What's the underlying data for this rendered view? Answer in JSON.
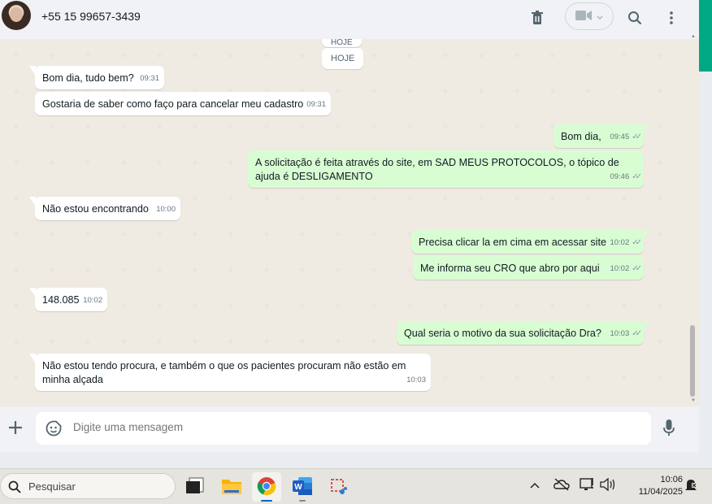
{
  "header": {
    "contact_name": "+55 15 99657-3439",
    "icons": [
      "delete-icon",
      "video-call-icon",
      "chevron-down-icon",
      "search-icon",
      "menu-icon"
    ]
  },
  "chat": {
    "date_chips": [
      "HOJE",
      "HOJE"
    ],
    "messages": [
      {
        "dir": "in",
        "text": "Bom dia, tudo bem?",
        "time": "09:31"
      },
      {
        "dir": "in",
        "text": "Gostaria de saber como faço para cancelar meu cadastro",
        "time": "09:31"
      },
      {
        "dir": "out",
        "text": "Bom dia,",
        "time": "09:45"
      },
      {
        "dir": "out",
        "text": "A solicitação é feita através do site, em SAD MEUS PROTOCOLOS, o tópico de ajuda é DESLIGAMENTO",
        "time": "09:46"
      },
      {
        "dir": "in",
        "text": "Não estou encontrando",
        "time": "10:00"
      },
      {
        "dir": "out",
        "text": "Precisa clicar la em cima em acessar site",
        "time": "10:02"
      },
      {
        "dir": "out",
        "text": "Me informa seu CRO que abro por aqui",
        "time": "10:02"
      },
      {
        "dir": "in",
        "text": "148.085",
        "time": "10:02"
      },
      {
        "dir": "out",
        "text": "Qual seria o motivo da sua solicitação Dra?",
        "time": "10:03"
      },
      {
        "dir": "in",
        "text": "Não estou tendo procura, e também o que os pacientes procuram não estão em minha alçada",
        "time": "10:03"
      }
    ]
  },
  "composer": {
    "placeholder": "Digite uma mensagem"
  },
  "taskbar": {
    "search_placeholder": "Pesquisar",
    "time": "10:06",
    "date": "11/04/2025"
  },
  "colors": {
    "incoming_bubble": "#ffffff",
    "outgoing_bubble": "#d9fdd3",
    "accent": "#00a884"
  }
}
